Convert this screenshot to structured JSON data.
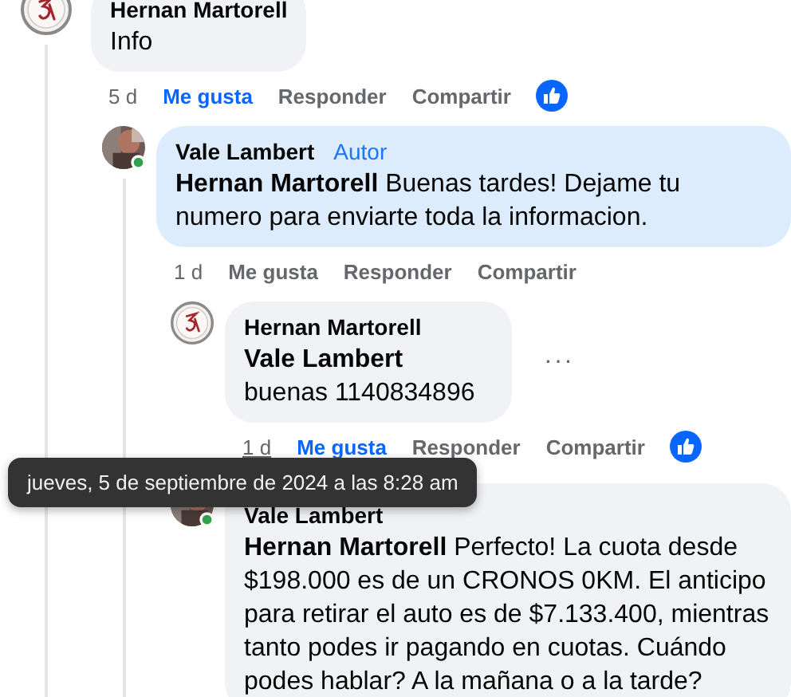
{
  "comments": [
    {
      "author": "Hernan Martorell",
      "avatar": {
        "kind": "emblem"
      },
      "online": false,
      "highlighted": false,
      "text": "Info",
      "time": "5 d",
      "time_hovered": false,
      "actions": [
        {
          "label": "Me gusta",
          "selected": true
        },
        {
          "label": "Responder",
          "selected": false
        },
        {
          "label": "Compartir",
          "selected": false
        }
      ],
      "reaction": true,
      "children": [
        {
          "author": "Vale Lambert",
          "badge": "Autor",
          "avatar": {
            "kind": "photo"
          },
          "online": true,
          "highlighted": true,
          "text": "**Hernan Martorell** Buenas tardes! Dejame tu numero para enviarte toda la informacion.",
          "time": "1 d",
          "time_hovered": false,
          "actions": [
            {
              "label": "Me gusta",
              "selected": false
            },
            {
              "label": "Responder",
              "selected": false
            },
            {
              "label": "Compartir",
              "selected": false
            }
          ],
          "reaction": false,
          "children": [
            {
              "author": "Hernan Martorell",
              "avatar": {
                "kind": "emblem"
              },
              "online": false,
              "highlighted": false,
              "text": "**Vale Lambert** buenas 1140834896",
              "menu": "···",
              "time": "1 d",
              "time_hovered": true,
              "actions": [
                {
                  "label": "Me gusta",
                  "selected": true
                },
                {
                  "label": "Responder",
                  "selected": false
                },
                {
                  "label": "Compartir",
                  "selected": false
                }
              ],
              "reaction": true
            },
            {
              "author": "Vale Lambert",
              "avatar": {
                "kind": "photo"
              },
              "online": true,
              "highlighted": false,
              "text": "**Hernan Martorell** Perfecto! La cuota desde $198.000 es de un CRONOS 0KM. El anticipo para retirar el auto es de $7.133.400, mientras tanto podes ir pagando en cuotas. Cuándo podes hablar? A la mañana o a la tarde?"
            }
          ]
        }
      ]
    }
  ],
  "tooltip": {
    "text": "jueves, 5 de septiembre de 2024 a las 8:28 am"
  }
}
